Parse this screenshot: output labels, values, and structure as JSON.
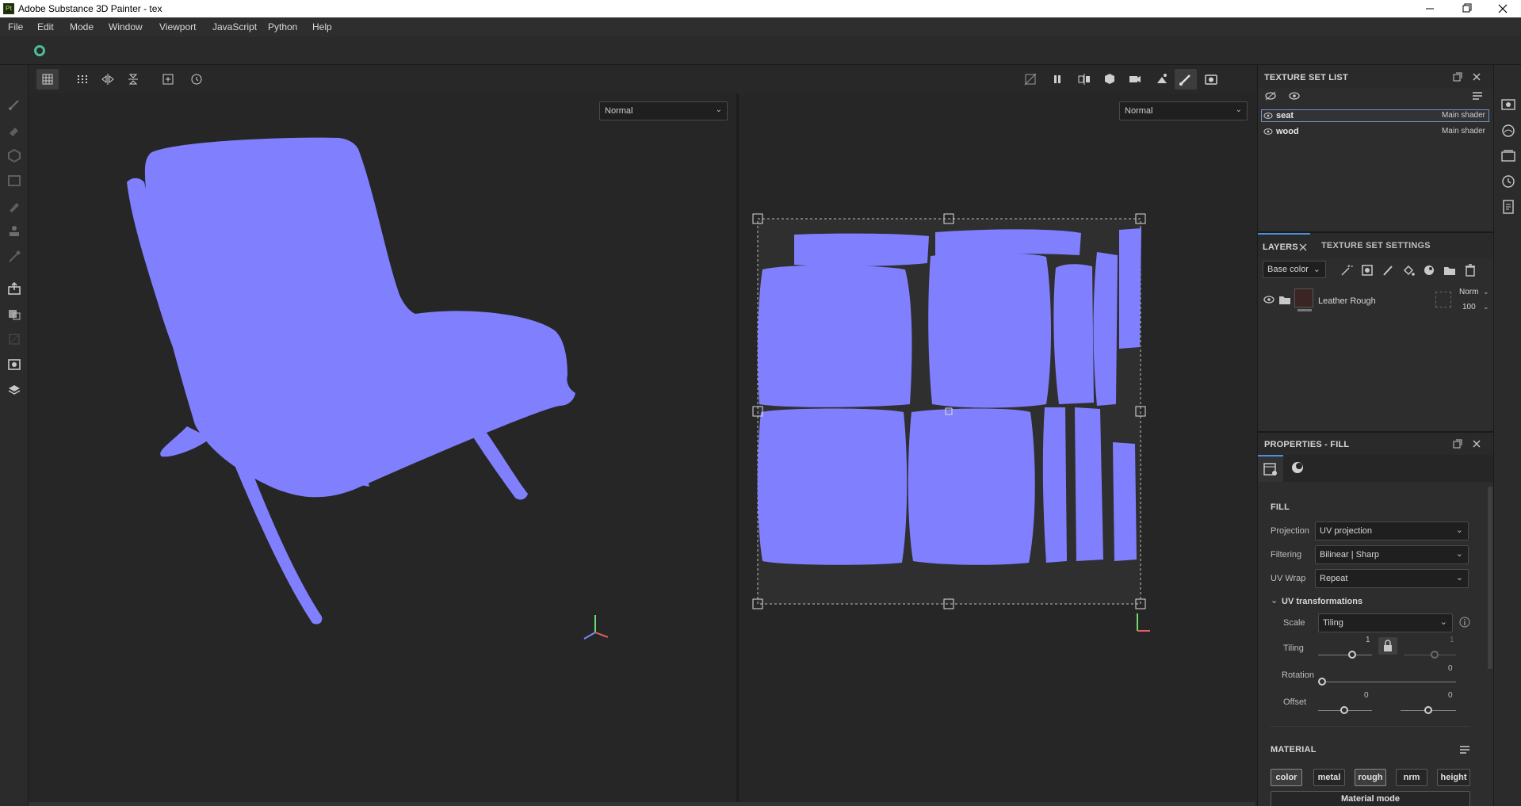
{
  "window": {
    "title": "Adobe Substance 3D Painter - tex",
    "app_icon": "Pt"
  },
  "menu": [
    "File",
    "Edit",
    "Mode",
    "Window",
    "Viewport",
    "JavaScript",
    "Python",
    "Help"
  ],
  "viewport_3d": {
    "mode": "Normal"
  },
  "viewport_2d": {
    "mode": "Normal"
  },
  "texture_set_list": {
    "title": "TEXTURE SET LIST",
    "items": [
      {
        "name": "seat",
        "shader": "Main shader",
        "selected": true
      },
      {
        "name": "wood",
        "shader": "Main shader",
        "selected": false
      }
    ]
  },
  "layers": {
    "tab_layers": "LAYERS",
    "tab_settings": "TEXTURE SET SETTINGS",
    "channel": "Base color",
    "items": [
      {
        "name": "Leather Rough",
        "blend": "Norm",
        "opacity": "100"
      }
    ]
  },
  "properties": {
    "title": "PROPERTIES - FILL",
    "section_fill": "FILL",
    "projection_label": "Projection",
    "projection_value": "UV projection",
    "filtering_label": "Filtering",
    "filtering_value": "Bilinear | Sharp",
    "uvwrap_label": "UV Wrap",
    "uvwrap_value": "Repeat",
    "uv_transformations": "UV transformations",
    "scale_label": "Scale",
    "scale_value": "Tiling",
    "tiling_label": "Tiling",
    "tiling_u": "1",
    "tiling_v": "1",
    "rotation_label": "Rotation",
    "rotation_value": "0",
    "offset_label": "Offset",
    "offset_u": "0",
    "offset_v": "0",
    "section_material": "MATERIAL",
    "channels": [
      "color",
      "metal",
      "rough",
      "nrm",
      "height"
    ],
    "material_mode": "Material mode"
  },
  "accent_color": "#8080ff"
}
